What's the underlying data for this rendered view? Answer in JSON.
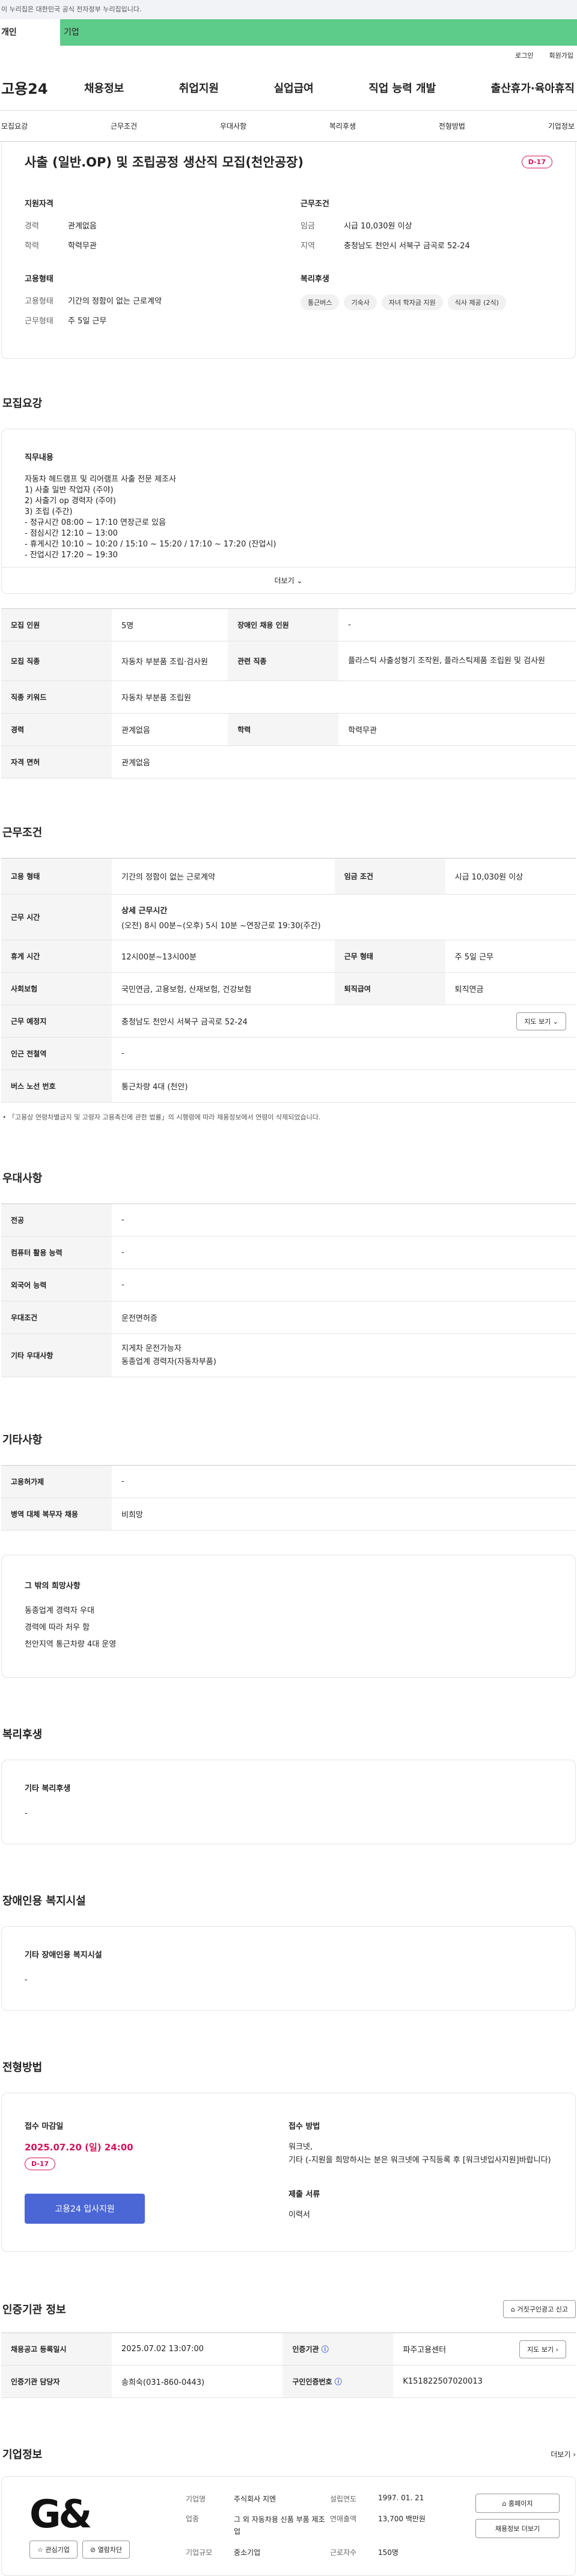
{
  "gov_banner": "이 누리집은 대한민국 공식 전자정부 누리집입니다.",
  "top_tabs": {
    "person": "개인",
    "company": "기업"
  },
  "util": {
    "login": "로그인",
    "join": "회원가입"
  },
  "logo": "고용24",
  "gnb": [
    "채용정보",
    "취업지원",
    "실업급여",
    "직업 능력 개발",
    "출산휴가·육아휴직"
  ],
  "subtabs": [
    "모집요강",
    "근무조건",
    "우대사항",
    "복리후생",
    "전형방법",
    "기업정보"
  ],
  "summary": {
    "title": "사출 (일반.OP) 및 조립공정 생산직 모집(천안공장)",
    "dday": "D-17",
    "qual_title": "지원자격",
    "qual": [
      {
        "k": "경력",
        "v": "관계없음"
      },
      {
        "k": "학력",
        "v": "학력무관"
      }
    ],
    "cond_title": "근무조건",
    "cond": [
      {
        "k": "임금",
        "v": "시급 10,030원 이상"
      },
      {
        "k": "지역",
        "v": "충청남도 천안시 서북구 금곡로 52-24"
      }
    ],
    "emp_title": "고용형태",
    "emp": [
      {
        "k": "고용형태",
        "v": "기간의 정함이 없는 근로계약"
      },
      {
        "k": "근무형태",
        "v": "주 5일 근무"
      }
    ],
    "welfare_title": "복리후생",
    "welfare": [
      "통근버스",
      "기숙사",
      "자녀 학자금 지원",
      "식사 제공 (2식)"
    ]
  },
  "recruit": {
    "title": "모집요강",
    "duty_title": "직무내용",
    "duty_lines": [
      "자동차 헤드램프 및 리어램프 사출 전문 제조사",
      "1) 사출 일반 작업자 (주야)",
      "2) 사출기 op 경력자 (주야)",
      "3) 조립 (주간)",
      "- 정규시간 08:00 ~ 17:10 연장근로 있음",
      "- 점심시간 12:10 ~ 13:00",
      "- 휴게시간 10:10 ~ 10:20 / 15:10 ~ 15:20 / 17:10 ~ 17:20 (잔업시)",
      "- 잔업시간 17:20 ~ 19:30"
    ],
    "more": "더보기",
    "rows": [
      {
        "k1": "모집 인원",
        "v1": "5명",
        "k2": "장애인 채용 인원",
        "v2": "-"
      },
      {
        "k1": "모집 직종",
        "v1": "자동차 부분품 조립·검사원",
        "k2": "관련 직종",
        "v2": "플라스틱 사출성형기 조작원, 플라스틱제품 조립원 및 검사원"
      },
      {
        "k1": "직종 키워드",
        "v1": "자동차 부분품 조립원",
        "k2": "",
        "v2": ""
      },
      {
        "k1": "경력",
        "v1": "관계없음",
        "k2": "학력",
        "v2": "학력무관"
      },
      {
        "k1": "자격 면허",
        "v1": "관계없음",
        "k2": "",
        "v2": ""
      }
    ]
  },
  "work": {
    "title": "근무조건",
    "employ_k": "고용 형태",
    "employ_v": "기간의 정함이 없는 근로계약",
    "wage_k": "임금 조건",
    "wage_v": "시급 10,030원 이상",
    "time_k": "근무 시간",
    "time_sub": "상세 근무시간",
    "time_v": "(오전) 8시 00분~(오후) 5시 10분 ~연장근로 19:30(주간)",
    "rest_k": "휴게 시간",
    "rest_v": "12시00분~13시00분",
    "type_k": "근무 형태",
    "type_v": "주 5일 근무",
    "ins_k": "사회보험",
    "ins_v": "국민연금, 고용보험, 산재보험, 건강보험",
    "ret_k": "퇴직급여",
    "ret_v": "퇴직연금",
    "place_k": "근무 예정지",
    "place_v": "충청남도 천안시 서북구 금곡로 52-24",
    "map_btn": "지도 보기",
    "station_k": "인근 전철역",
    "station_v": "-",
    "bus_k": "버스 노선 번호",
    "bus_v": "통근차량 4대 (천안)",
    "note": "「고용상 연령차별금지 및 고령자 고용촉진에 관한 법률」의 시행령에 따라 채용정보에서 연령이 삭제되었습니다."
  },
  "pref": {
    "title": "우대사항",
    "rows": [
      {
        "k": "전공",
        "v": "-"
      },
      {
        "k": "컴퓨터 활용 능력",
        "v": "-"
      },
      {
        "k": "외국어 능력",
        "v": "-"
      },
      {
        "k": "우대조건",
        "v": "운전면허증"
      },
      {
        "k": "기타 우대사항",
        "v": "지게차 운전가능자",
        "v2": "동종업계 경력자(자동차부품)"
      }
    ]
  },
  "etc": {
    "title": "기타사항",
    "rows": [
      {
        "k": "고용허가제",
        "v": "-"
      },
      {
        "k": "병역 대체 복무자 채용",
        "v": "비희망"
      }
    ],
    "box_title": "그 밖의 희망사항",
    "box_lines": [
      "동종업계 경력자 우대",
      "경력에 따라 처우 함",
      "천안지역 통근차량 4대 운영"
    ]
  },
  "welfare": {
    "title": "복리후생",
    "box_title": "기타 복리후생",
    "box_v": "-"
  },
  "disabled": {
    "title": "장애인용 복지시설",
    "box_title": "기타 장애인용 복지시설",
    "box_v": "-"
  },
  "process": {
    "title": "전형방법",
    "deadline_title": "접수 마감일",
    "deadline": "2025.07.20 (일) 24:00",
    "dday": "D-17",
    "apply_btn": "고용24 입사지원",
    "method_title": "접수 방법",
    "method_lines": [
      "워크넷,",
      "기타 (-지원을 희망하시는 분은 워크넷에 구직등록 후 [워크넷입사지원]바랍니다)"
    ],
    "docs_title": "제출 서류",
    "docs_v": "이력서"
  },
  "agency": {
    "title": "인증기관 정보",
    "report_btn": "거짓구인광고 신고",
    "reg_k": "채용공고 등록일시",
    "reg_v": "2025.07.02 13:07:00",
    "org_k": "인증기관",
    "org_v": "파주고용센터",
    "map_btn": "지도 보기",
    "mgr_k": "인증기관 담당자",
    "mgr_v": "송희숙(031-860-0443)",
    "num_k": "구인인증번호",
    "num_v": "K151822507020013"
  },
  "company": {
    "title": "기업정보",
    "more": "더보기",
    "logo_text": "G&",
    "fav_btn": "관심기업",
    "block_btn": "열람차단",
    "name_k": "기업명",
    "name_v": "주식회사 지엔",
    "ind_k": "업종",
    "ind_v": "그 외 자동차용 신품 부품 제조업",
    "size_k": "기업규모",
    "size_v": "중소기업",
    "est_k": "설립연도",
    "est_v": "1997. 01. 21",
    "sales_k": "연매출액",
    "sales_v": "13,700 백만원",
    "emp_k": "근로자수",
    "emp_v": "150명",
    "home_btn": "홈페이지",
    "jobs_btn": "채용정보 더보기"
  },
  "colors": {
    "accent": "#4b67d6",
    "dday": "#d4145a",
    "company_tab": "#5dcb8a"
  }
}
